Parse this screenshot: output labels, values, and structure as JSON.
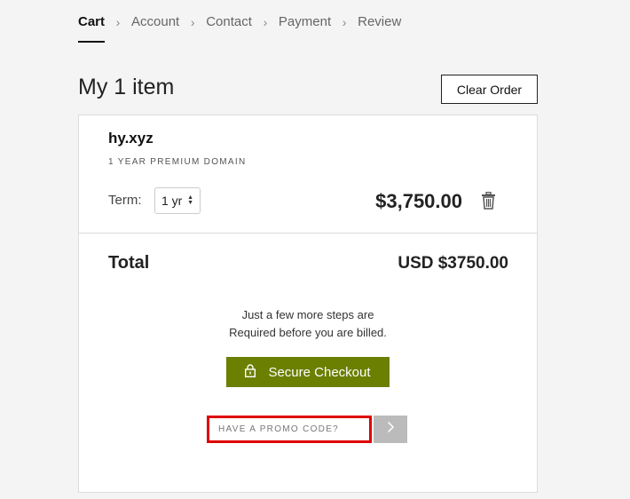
{
  "breadcrumb": {
    "items": [
      "Cart",
      "Account",
      "Contact",
      "Payment",
      "Review"
    ],
    "separator": "›"
  },
  "header": {
    "title": "My 1 item",
    "clear_label": "Clear Order"
  },
  "cart": {
    "item_name": "hy.xyz",
    "item_type": "1 YEAR PREMIUM DOMAIN",
    "term_label": "Term:",
    "term_value": "1 yr",
    "price": "$3,750.00",
    "delete_icon": "trash-icon"
  },
  "summary": {
    "total_label": "Total",
    "total_value": "USD $3750.00",
    "steps_line1": "Just a few more steps are",
    "steps_line2": "Required before you are billed.",
    "checkout_label": "Secure Checkout",
    "checkout_icon": "lock-icon"
  },
  "promo": {
    "placeholder": "HAVE A PROMO CODE?",
    "submit_icon": "chevron-right-icon"
  },
  "colors": {
    "checkout": "#6b7f00",
    "highlight": "#e00000",
    "promo_button": "#bbbbbb"
  }
}
